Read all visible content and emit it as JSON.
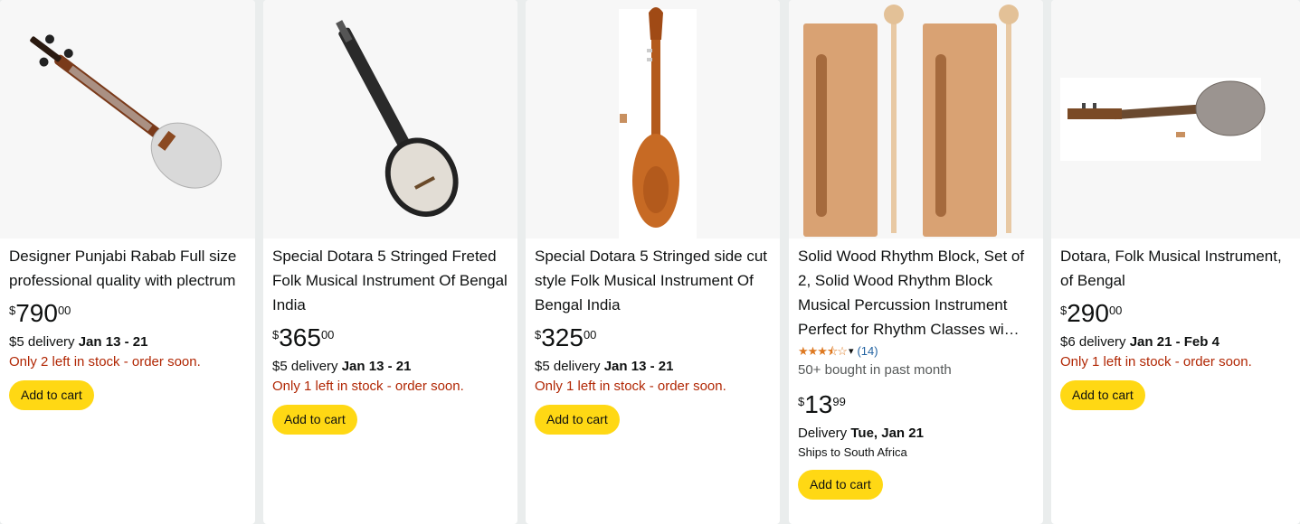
{
  "products": [
    {
      "title": "Designer Punjabi Rabab Full size professional quality with plectrum",
      "price": {
        "symbol": "$",
        "whole": "790",
        "fraction": "00"
      },
      "delivery_prefix": "$5 delivery ",
      "delivery_date": "Jan 13 - 21",
      "stock": "Only 2 left in stock - order soon.",
      "add_to_cart": "Add to cart"
    },
    {
      "title": "Special Dotara 5 Stringed Freted Folk Musical Instrument Of Bengal India",
      "price": {
        "symbol": "$",
        "whole": "365",
        "fraction": "00"
      },
      "delivery_prefix": "$5 delivery ",
      "delivery_date": "Jan 13 - 21",
      "stock": "Only 1 left in stock - order soon.",
      "add_to_cart": "Add to cart"
    },
    {
      "title": "Special Dotara 5 Stringed side cut style Folk Musical Instrument Of Bengal India",
      "price": {
        "symbol": "$",
        "whole": "325",
        "fraction": "00"
      },
      "delivery_prefix": "$5 delivery ",
      "delivery_date": "Jan 13 - 21",
      "stock": "Only 1 left in stock - order soon.",
      "add_to_cart": "Add to cart"
    },
    {
      "title": "Solid Wood Rhythm Block, Set of 2, Solid Wood Rhythm Block Musical Percussion Instrument Perfect for Rhythm Classes wi…",
      "rating": {
        "stars": 3.5,
        "count": "(14)"
      },
      "bought": "50+ bought in past month",
      "price": {
        "symbol": "$",
        "whole": "13",
        "fraction": "99"
      },
      "delivery_prefix": "Delivery ",
      "delivery_date": "Tue, Jan 21",
      "ships": "Ships to South Africa",
      "add_to_cart": "Add to cart"
    },
    {
      "title": "Dotara, Folk Musical Instrument, of Bengal",
      "price": {
        "symbol": "$",
        "whole": "290",
        "fraction": "00"
      },
      "delivery_prefix": "$6 delivery ",
      "delivery_date": "Jan 21 - Feb 4",
      "stock": "Only 1 left in stock - order soon.",
      "add_to_cart": "Add to cart"
    }
  ],
  "icons": {
    "rating": "star-rating-icon",
    "chevron": "chevron-down-icon"
  },
  "colors": {
    "button": "#ffd814",
    "stock": "#b12704",
    "star": "#de7921",
    "link": "#2162a1",
    "background": "#eaeded"
  }
}
